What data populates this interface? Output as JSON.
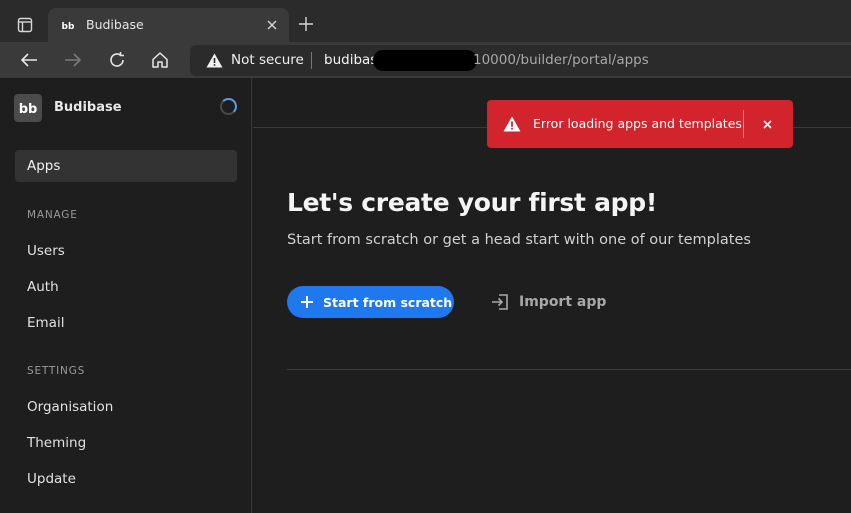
{
  "browser": {
    "tab_title": "Budibase",
    "security_label": "Not secure",
    "url_host": "budibas",
    "url_path": "10000/builder/portal/apps"
  },
  "sidebar": {
    "brand": "Budibase",
    "active_item": "Apps",
    "sections": [
      {
        "label": "MANAGE",
        "items": [
          "Users",
          "Auth",
          "Email"
        ]
      },
      {
        "label": "SETTINGS",
        "items": [
          "Organisation",
          "Theming",
          "Update"
        ]
      }
    ]
  },
  "main": {
    "heading": "Let's create your first app!",
    "subheading": "Start from scratch or get a head start with one of our templates",
    "primary_button": "Start from scratch",
    "secondary_button": "Import app"
  },
  "toast": {
    "message": "Error loading apps and templates"
  },
  "colors": {
    "accent_blue": "#1f78ee",
    "error_red": "#d2242c",
    "background": "#1e1e1e"
  }
}
